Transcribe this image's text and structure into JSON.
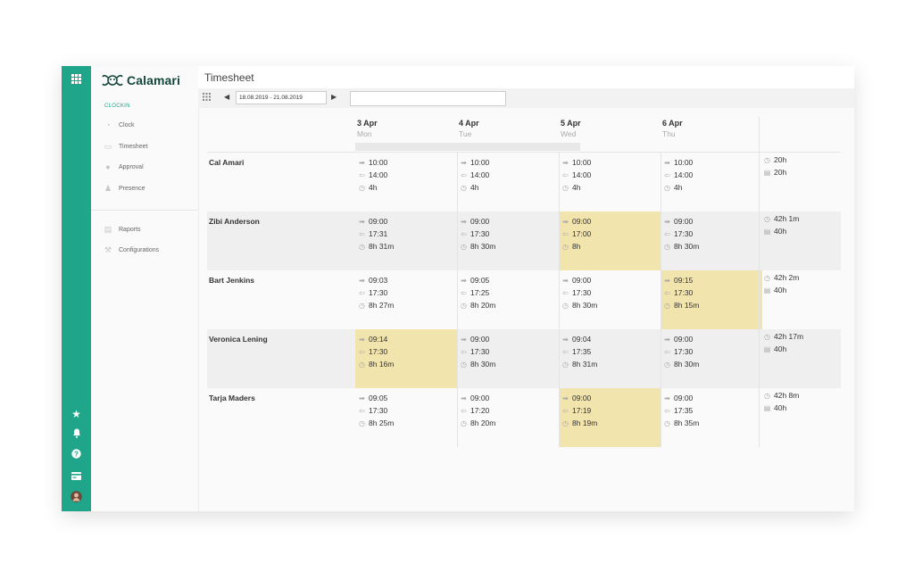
{
  "app": {
    "name": "Calamari"
  },
  "sidebar": {
    "section_label": "CLOCKIN",
    "items": [
      {
        "label": "Clock",
        "icon": "clock-icon"
      },
      {
        "label": "Timesheet",
        "icon": "timesheet-icon"
      },
      {
        "label": "Approval",
        "icon": "approval-icon"
      },
      {
        "label": "Presence",
        "icon": "presence-icon"
      },
      {
        "label": "Raports",
        "icon": "reports-icon"
      },
      {
        "label": "Configurations",
        "icon": "wrench-icon"
      }
    ]
  },
  "rail_icons": [
    "apps-grid-icon",
    "star-icon",
    "bell-icon",
    "help-icon",
    "card-icon",
    "avatar"
  ],
  "header": {
    "title": "Timesheet"
  },
  "toolbar": {
    "date_range": "18.08.2019 - 21.08.2019",
    "search_placeholder": ""
  },
  "days": [
    {
      "date": "3 Apr",
      "weekday": "Mon"
    },
    {
      "date": "4 Apr",
      "weekday": "Tue"
    },
    {
      "date": "5 Apr",
      "weekday": "Wed"
    },
    {
      "date": "6 Apr",
      "weekday": "Thu"
    }
  ],
  "colors": {
    "accent": "#1fa58a",
    "highlight": "#f2e4ad",
    "logo_text": "#12473a"
  },
  "rows": [
    {
      "name": "Cal Amari",
      "cells": [
        {
          "in": "10:00",
          "out": "14:00",
          "dur": "4h",
          "highlight": false
        },
        {
          "in": "10:00",
          "out": "14:00",
          "dur": "4h",
          "highlight": false
        },
        {
          "in": "10:00",
          "out": "14:00",
          "dur": "4h",
          "highlight": false
        },
        {
          "in": "10:00",
          "out": "14:00",
          "dur": "4h",
          "highlight": false
        }
      ],
      "total_worked": "20h",
      "total_planned": "20h"
    },
    {
      "name": "Zibi Anderson",
      "cells": [
        {
          "in": "09:00",
          "out": "17:31",
          "dur": "8h 31m",
          "highlight": false
        },
        {
          "in": "09:00",
          "out": "17:30",
          "dur": "8h 30m",
          "highlight": false
        },
        {
          "in": "09:00",
          "out": "17:00",
          "dur": "8h",
          "highlight": true
        },
        {
          "in": "09:00",
          "out": "17:30",
          "dur": "8h 30m",
          "highlight": false
        }
      ],
      "total_worked": "42h 1m",
      "total_planned": "40h"
    },
    {
      "name": "Bart Jenkins",
      "cells": [
        {
          "in": "09:03",
          "out": "17:30",
          "dur": "8h 27m",
          "highlight": false
        },
        {
          "in": "09:05",
          "out": "17:25",
          "dur": "8h 20m",
          "highlight": false
        },
        {
          "in": "09:00",
          "out": "17:30",
          "dur": "8h 30m",
          "highlight": false
        },
        {
          "in": "09:15",
          "out": "17:30",
          "dur": "8h 15m",
          "highlight": true
        }
      ],
      "total_worked": "42h 2m",
      "total_planned": "40h"
    },
    {
      "name": "Veronica Lening",
      "cells": [
        {
          "in": "09:14",
          "out": "17:30",
          "dur": "8h 16m",
          "highlight": true
        },
        {
          "in": "09:00",
          "out": "17:30",
          "dur": "8h 30m",
          "highlight": false
        },
        {
          "in": "09:04",
          "out": "17:35",
          "dur": "8h 31m",
          "highlight": false
        },
        {
          "in": "09:00",
          "out": "17:30",
          "dur": "8h 30m",
          "highlight": false
        }
      ],
      "total_worked": "42h 17m",
      "total_planned": "40h"
    },
    {
      "name": "Tarja Maders",
      "cells": [
        {
          "in": "09:05",
          "out": "17:30",
          "dur": "8h 25m",
          "highlight": false
        },
        {
          "in": "09:00",
          "out": "17:20",
          "dur": "8h 20m",
          "highlight": false
        },
        {
          "in": "09:00",
          "out": "17:19",
          "dur": "8h 19m",
          "highlight": true
        },
        {
          "in": "09:00",
          "out": "17:35",
          "dur": "8h 35m",
          "highlight": false
        }
      ],
      "total_worked": "42h 8m",
      "total_planned": "40h"
    }
  ]
}
